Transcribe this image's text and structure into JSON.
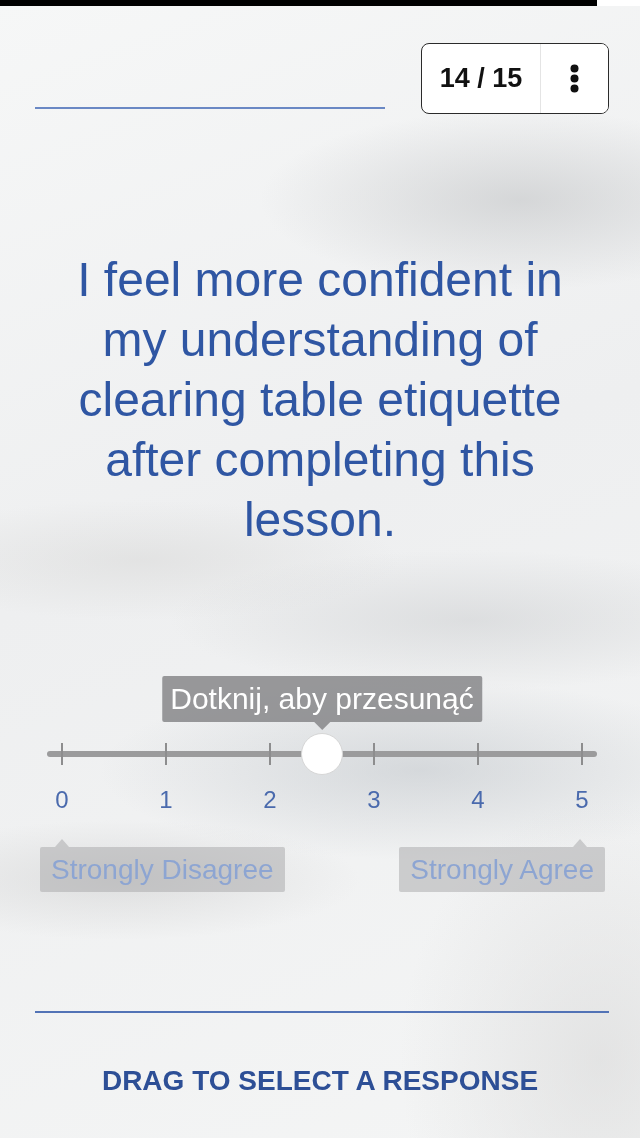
{
  "progress": {
    "level": 0.933
  },
  "header": {
    "counter": "14 / 15"
  },
  "question": "I feel more confident in my understanding of clearing table etiquette after completing this lesson.",
  "slider": {
    "tooltip": "Dotknij, aby przesunąć",
    "level": 0.5,
    "ticks": [
      "0",
      "1",
      "2",
      "3",
      "4",
      "5"
    ],
    "end_labels": [
      "Strongly Disagree",
      "Strongly Agree"
    ]
  },
  "footer": {
    "instruction": "DRAG TO SELECT A RESPONSE"
  }
}
